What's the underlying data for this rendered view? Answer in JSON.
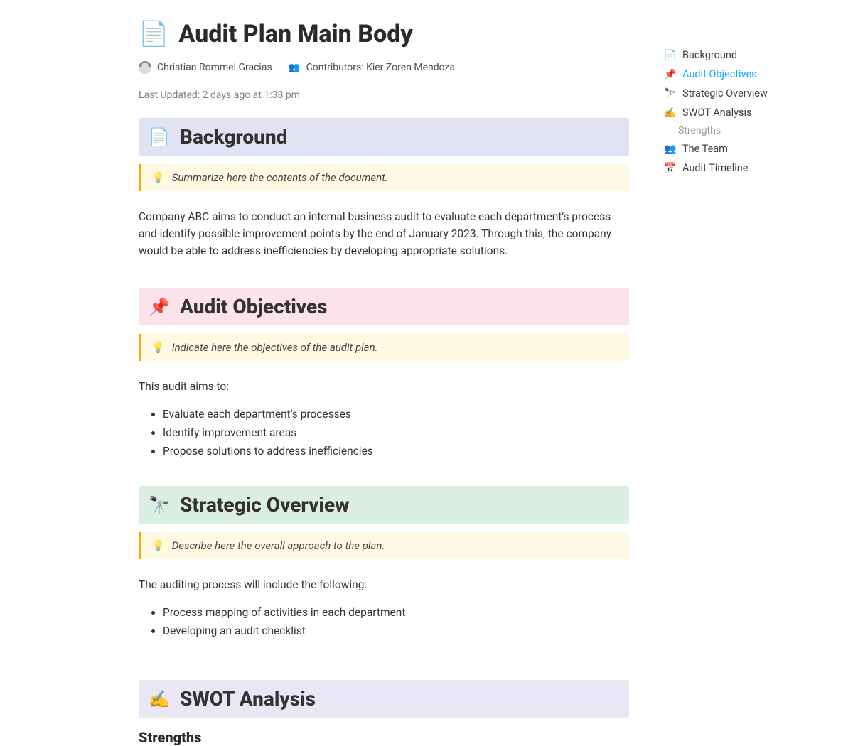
{
  "page": {
    "icon": "📄",
    "title": "Audit Plan Main Body",
    "author": "Christian Rommel Gracias",
    "contributors_label": "Contributors:",
    "contributors": "Kier Zoren Mendoza",
    "updated_label": "Last Updated:",
    "updated_value": "2 days ago at 1:38 pm"
  },
  "sections": {
    "background": {
      "icon": "📄",
      "title": "Background",
      "callout": "Summarize here the contents of the document.",
      "body": "Company ABC aims to conduct an internal business audit to evaluate each department's process and identify possible improvement points by the end of January 2023. Through this, the company would be able to address inefficiencies by developing appropriate solutions."
    },
    "objectives": {
      "icon": "📌",
      "title": "Audit Objectives",
      "callout": "Indicate here the objectives of the audit plan.",
      "intro": "This audit aims to:",
      "items": [
        "Evaluate each department's processes",
        "Identify improvement areas",
        "Propose solutions to address inefficiencies"
      ]
    },
    "strategic": {
      "icon": "🔭",
      "title": "Strategic Overview",
      "callout": "Describe here the overall approach to the plan.",
      "intro": "The auditing process will include the following:",
      "items": [
        "Process mapping of activities in each department",
        "Developing an audit checklist"
      ]
    },
    "swot": {
      "icon": "✍️",
      "title": "SWOT Analysis",
      "sub1": "Strengths"
    }
  },
  "toc": {
    "items": [
      {
        "icon": "📄",
        "label": "Background",
        "active": false
      },
      {
        "icon": "📌",
        "label": "Audit Objectives",
        "active": true
      },
      {
        "icon": "🔭",
        "label": "Strategic Overview",
        "active": false
      },
      {
        "icon": "✍️",
        "label": "SWOT Analysis",
        "active": false
      }
    ],
    "sub": "Strengths",
    "items2": [
      {
        "icon": "👥",
        "label": "The Team"
      },
      {
        "icon": "📅",
        "label": "Audit Timeline"
      }
    ]
  }
}
